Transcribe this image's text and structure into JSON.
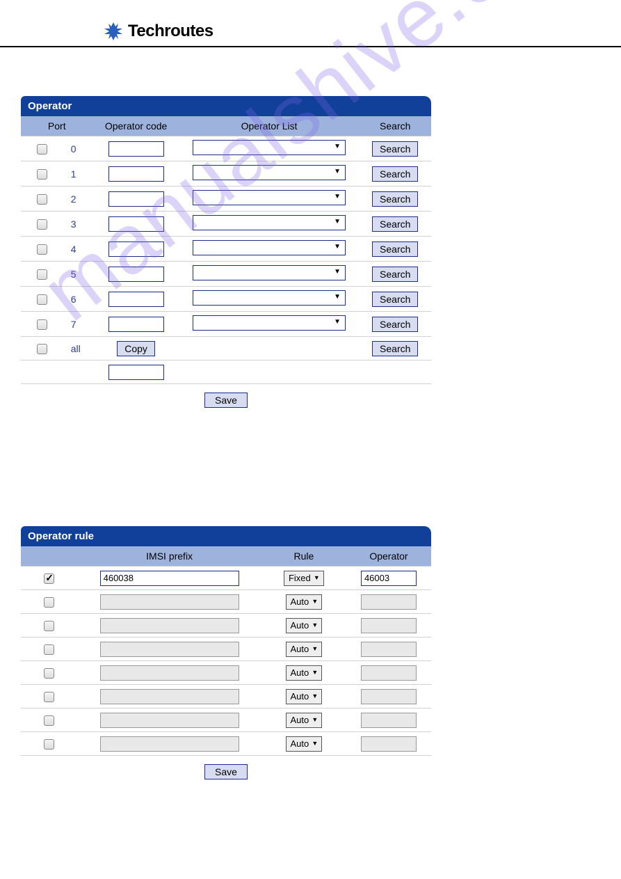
{
  "brand": "Techroutes",
  "watermark": "manualshive.com",
  "operator_panel": {
    "title": "Operator",
    "headers": {
      "port": "Port",
      "code": "Operator code",
      "list": "Operator List",
      "search": "Search"
    },
    "copy_label": "Copy",
    "search_label": "Search",
    "save_label": "Save",
    "all_label": "all",
    "rows": [
      {
        "port": "0"
      },
      {
        "port": "1"
      },
      {
        "port": "2"
      },
      {
        "port": "3"
      },
      {
        "port": "4"
      },
      {
        "port": "5"
      },
      {
        "port": "6"
      },
      {
        "port": "7"
      }
    ]
  },
  "rule_panel": {
    "title": "Operator rule",
    "headers": {
      "imsi": "IMSI prefix",
      "rule": "Rule",
      "operator": "Operator"
    },
    "save_label": "Save",
    "rule_options": {
      "fixed": "Fixed",
      "auto": "Auto"
    },
    "rows": [
      {
        "checked": true,
        "imsi": "460038",
        "rule": "Fixed",
        "operator": "46003",
        "enabled": true
      },
      {
        "checked": false,
        "imsi": "",
        "rule": "Auto",
        "operator": "",
        "enabled": false
      },
      {
        "checked": false,
        "imsi": "",
        "rule": "Auto",
        "operator": "",
        "enabled": false
      },
      {
        "checked": false,
        "imsi": "",
        "rule": "Auto",
        "operator": "",
        "enabled": false
      },
      {
        "checked": false,
        "imsi": "",
        "rule": "Auto",
        "operator": "",
        "enabled": false
      },
      {
        "checked": false,
        "imsi": "",
        "rule": "Auto",
        "operator": "",
        "enabled": false
      },
      {
        "checked": false,
        "imsi": "",
        "rule": "Auto",
        "operator": "",
        "enabled": false
      },
      {
        "checked": false,
        "imsi": "",
        "rule": "Auto",
        "operator": "",
        "enabled": false
      }
    ]
  }
}
